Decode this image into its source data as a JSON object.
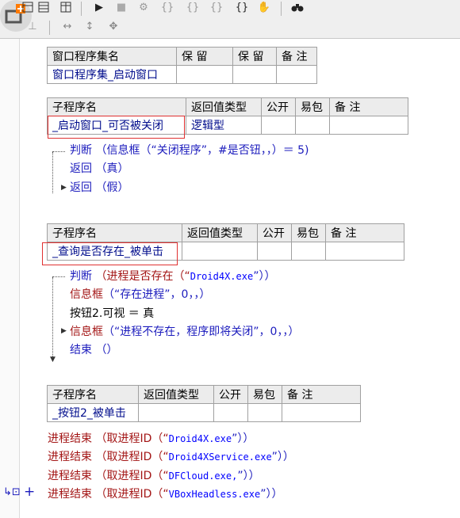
{
  "toolbar": {
    "icons": [
      "undo-icon",
      "table-view-icon",
      "table-icon",
      "run-icon",
      "stop-icon",
      "debug-icon",
      "step-into-icon",
      "step-over-icon",
      "step-out-icon",
      "braces-icon",
      "hand-icon",
      "binoculars-icon",
      "resize-h-icon",
      "resize-v-icon",
      "move-icon"
    ]
  },
  "module": {
    "headers": [
      "窗口程序集名",
      "保 留",
      "保 留",
      "备 注"
    ],
    "values": [
      "窗口程序集_启动窗口",
      "",
      "",
      ""
    ]
  },
  "sub1": {
    "headers": [
      "子程序名",
      "返回值类型",
      "公开",
      "易包",
      "备 注"
    ],
    "name": "_启动窗口_可否被关闭",
    "return_type": "逻辑型",
    "lines": {
      "l1_kw": "判断",
      "l1_rest": "（信息框（“关闭程序”，#是否钮，，）＝ 5)",
      "l2_kw": "返回",
      "l2_rest": "（真）",
      "l3_kw": "返回",
      "l3_rest": "（假）"
    }
  },
  "sub2": {
    "headers": [
      "子程序名",
      "返回值类型",
      "公开",
      "易包",
      "备 注"
    ],
    "name": "_查询是否存在_被单击",
    "lines": {
      "l1_kw": "判断",
      "l1_fn": "（进程是否存在（“",
      "l1_str": "Droid4X.exe",
      "l1_end": "”））",
      "l2_fn": "信息框",
      "l2_rest": "（“存在进程”，0，，）",
      "l3": "按钮2.可视 ＝ 真",
      "l4_fn": "信息框",
      "l4_rest": "（“进程不存在，程序即将关闭”，0，，）",
      "l5_kw": "结束",
      "l5_rest": "（）"
    }
  },
  "sub3": {
    "headers": [
      "子程序名",
      "返回值类型",
      "公开",
      "易包",
      "备 注"
    ],
    "name": "_按钮2_被单击",
    "lines": [
      {
        "fn": "进程结束",
        "mid": "（取进程ID（“",
        "str": "Droid4X.exe",
        "end": "”））"
      },
      {
        "fn": "进程结束",
        "mid": "（取进程ID（“",
        "str": "Droid4XService.exe",
        "end": "”））"
      },
      {
        "fn": "进程结束",
        "mid": "（取进程ID（“",
        "str": "DFCloud.exe,",
        "end": "”））"
      },
      {
        "fn": "进程结束",
        "mid": "（取进程ID（“",
        "str": "VBoxHeadless.exe",
        "end": "”））"
      }
    ]
  },
  "gutter": {
    "marker": "+"
  }
}
